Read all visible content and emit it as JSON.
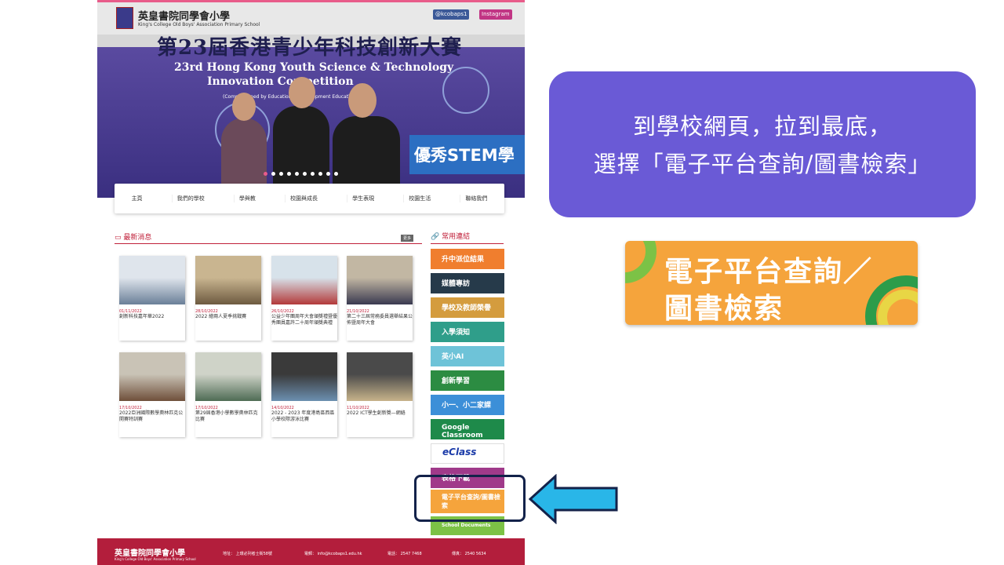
{
  "site": {
    "school_name": "英皇書院同學會小學",
    "school_sub": "King's College Old Boys' Association Primary School",
    "social": {
      "facebook": "@kcobaps1",
      "instagram": "Instagram"
    }
  },
  "banner": {
    "title_zh": "第23屆香港青少年科技創新大賽",
    "title_en1": "23rd Hong Kong Youth Science & Technology",
    "title_en2": "Innovation Competition",
    "commission": "(Commissioned by Education ... Development Education)",
    "stem_tag": "優秀STEM學",
    "slides": 10,
    "active_slide": 1
  },
  "nav": {
    "items": [
      "主頁",
      "我們的學校",
      "學與教",
      "校園與成長",
      "學生表現",
      "校園生活",
      "聯絡我們"
    ]
  },
  "news": {
    "title": "最新消息",
    "more": "更多",
    "cards": [
      {
        "date": "01/11/2022",
        "caption": "創新科技嘉年華2022",
        "colors": [
          "#dfe5ec",
          "#6a7f98"
        ]
      },
      {
        "date": "28/10/2022",
        "caption": "2022 繪兩人夏季挑戰賽",
        "colors": [
          "#c9b590",
          "#6d5a40"
        ]
      },
      {
        "date": "26/10/2022",
        "caption": "公益少年團周年大會頒獎禮暨優秀團員嘉許二十周年頒獎典禮",
        "colors": [
          "#d7e2ea",
          "#b33a3a"
        ]
      },
      {
        "date": "21/10/2022",
        "caption": "第二十三屆常務委員選舉結果公佈暨周年大會",
        "colors": [
          "#c2b7a3",
          "#3a3a50"
        ]
      },
      {
        "date": "17/10/2022",
        "caption": "2022亞洲國際數學奧林匹克公開賽特訓賽",
        "colors": [
          "#c9c3b6",
          "#6f4f3a"
        ]
      },
      {
        "date": "17/10/2022",
        "caption": "第29屆香港小學數學奧林匹克比賽",
        "colors": [
          "#cfd3c8",
          "#4e6b54"
        ]
      },
      {
        "date": "14/10/2022",
        "caption": "2022 - 2023 年度港島區西區小學校際游泳比賽",
        "colors": [
          "#3a3a3a",
          "#6b8fb0"
        ]
      },
      {
        "date": "11/10/2022",
        "caption": "2022 ICT學生創新獎—網絡",
        "colors": [
          "#4a4a4a",
          "#c7b38a"
        ]
      }
    ]
  },
  "links": {
    "title": "常用連結",
    "items": [
      {
        "label": "升中派位結果",
        "color": "#f07e2e"
      },
      {
        "label": "媒體專訪",
        "color": "#263a4a"
      },
      {
        "label": "學校及教師榮譽",
        "color": "#d49c3e"
      },
      {
        "label": "入學須知",
        "color": "#2f9e8a"
      },
      {
        "label": "英小AI",
        "color": "#6ec3d8"
      },
      {
        "label": "創新學習",
        "color": "#2c8c42"
      },
      {
        "label": "小一、小二家課",
        "color": "#3c8fd8"
      },
      {
        "label": "Google Classroom",
        "color": "#1e8a4a"
      },
      {
        "label": "eClass",
        "color": "#ffffff"
      },
      {
        "label": "表格下載",
        "color": "#a03a8a"
      },
      {
        "label": "電子平台查詢/圖書檢索",
        "color": "#f5a43c"
      },
      {
        "label": "School Documents",
        "color": "#7cc246"
      }
    ]
  },
  "footer": {
    "name": "英皇書院同學會小學",
    "sub": "King's College Old Boys' Association Primary School",
    "address_label": "地址：",
    "address": "上環必列者士街58號",
    "email_label": "電郵：",
    "email": "info@kcobaps1.edu.hk",
    "phone_label": "電話：",
    "phone": "2547 7468",
    "fax_label": "傳真：",
    "fax": "2540 5634"
  },
  "callout": {
    "line1": "到學校網頁，拉到最底，",
    "line2": "選擇「電子平台查詢/圖書檢索」",
    "color": "#6a5ad6"
  },
  "big_button": {
    "line1": "電子平台查詢／",
    "line2": "圖書檢索",
    "color": "#f5a43c"
  },
  "arrow": {
    "color": "#29b6e8",
    "direction": "left"
  }
}
